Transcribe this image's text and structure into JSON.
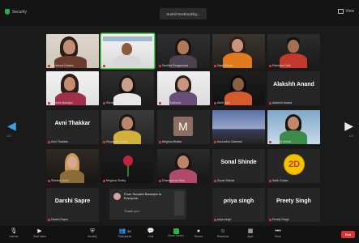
{
  "meeting": {
    "security_label": "Security",
    "title_pill": "Sushil Deshmukhg...",
    "view_label": "View"
  },
  "page": {
    "left": "1/3",
    "right": "1/3"
  },
  "participants": [
    {
      "label": "Karishma Dhakre"
    },
    {
      "label": "Dr Sangeeta Balasubramanian"
    },
    {
      "label": "Savitha Pedgaonkar"
    },
    {
      "label": "Sajal Pande"
    },
    {
      "label": "Ravindra Patil"
    },
    {
      "label": "Shweta Mahajan"
    },
    {
      "label": "Shruti Ganu"
    },
    {
      "label": "Swati Kathuria"
    },
    {
      "label": "Akriti Jain"
    },
    {
      "name": "Alakshh Anand",
      "label": "Alakshh Anand"
    },
    {
      "name": "Avni Thakkar",
      "label": "Avni Thakkar"
    },
    {
      "label": "Shyamala Shetty"
    },
    {
      "label": "Meghna Bhatia"
    },
    {
      "label": "Anuradha Gaikwad"
    },
    {
      "label": "Rachita Mehta"
    },
    {
      "label": "Sheetal Joshi"
    },
    {
      "label": "Meghna Shetty"
    },
    {
      "label": "Dhanashree Raut"
    },
    {
      "name": "Sonal Shinde",
      "label": "Sonal Shinde"
    },
    {
      "label": "Sahil Godse"
    },
    {
      "name": "Darshi Sapre",
      "label": "Darshi Sapre"
    },
    {
      "name": "priya singh",
      "label": "priya singh"
    },
    {
      "name": "Preety Singh",
      "label": "Preety Singh"
    }
  ],
  "chat_popup": {
    "from": "From Sunalini Banerjee to Everyone:",
    "message": "Thank you"
  },
  "toolbar": {
    "unmute": "Unmute",
    "start_video": "Start Video",
    "security": "Security",
    "participants": "Participants",
    "participants_count": "39",
    "chat": "Chat",
    "share_screen": "Share Screen",
    "record": "Record",
    "reactions": "Reactions",
    "apps": "Apps",
    "more": "More",
    "end": "End"
  },
  "colors": {
    "background": "#1a1a1a",
    "active_speaker": "#4bd04b",
    "end_button": "#e03030",
    "share_screen": "#25b34a",
    "nav_arrow": "#35a3e6"
  }
}
